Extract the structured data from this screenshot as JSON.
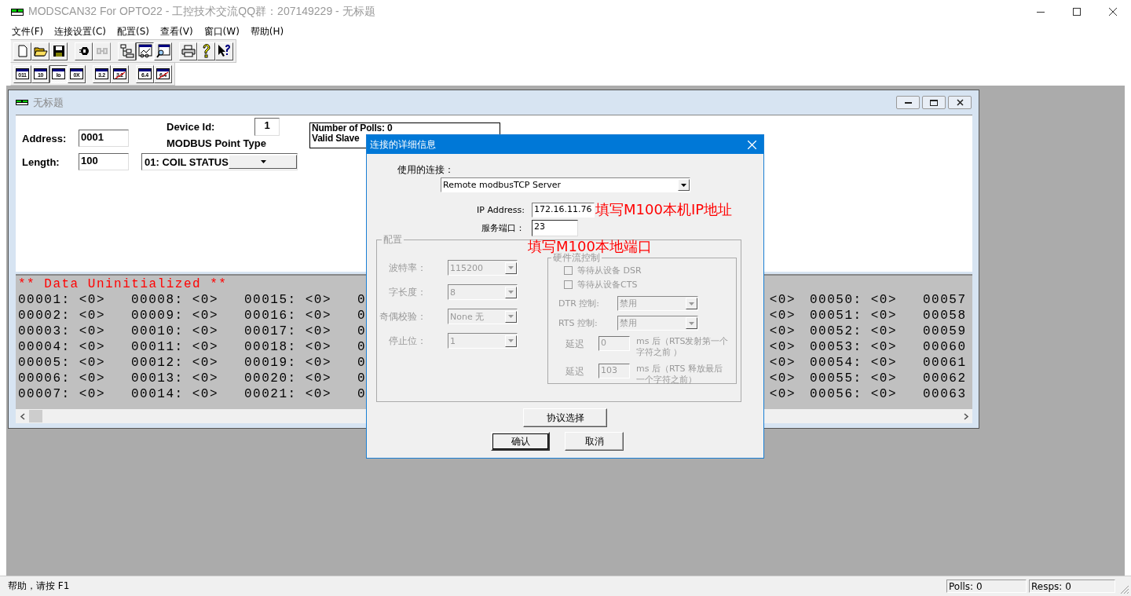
{
  "window": {
    "title": "MODSCAN32 For OPTO22 - 工控技术交流QQ群：207149229 - 无标题"
  },
  "menu": [
    "文件(F)",
    "连接设置(C)",
    "配置(S)",
    "查看(V)",
    "窗口(W)",
    "帮助(H)"
  ],
  "toolbar": [
    {
      "kind": "new",
      "disabled": false,
      "pressed": false
    },
    {
      "kind": "open",
      "disabled": false,
      "pressed": false
    },
    {
      "kind": "save",
      "disabled": false,
      "pressed": false
    },
    {
      "kind": "separator"
    },
    {
      "kind": "connect",
      "disabled": false,
      "pressed": false
    },
    {
      "kind": "disconnect",
      "disabled": true,
      "pressed": false
    },
    {
      "kind": "separator"
    },
    {
      "kind": "tree",
      "disabled": false,
      "pressed": false
    },
    {
      "kind": "display",
      "disabled": false,
      "pressed": true
    },
    {
      "kind": "inspect",
      "disabled": false,
      "pressed": false
    },
    {
      "kind": "separator"
    },
    {
      "kind": "print",
      "disabled": false,
      "pressed": false
    },
    {
      "kind": "help",
      "disabled": false,
      "pressed": false
    },
    {
      "kind": "contexthelp",
      "disabled": false,
      "pressed": false
    }
  ],
  "format_toolbar": [
    {
      "kind": "plain",
      "label": "011",
      "pressed": false
    },
    {
      "kind": "plain",
      "label": "10",
      "pressed": false
    },
    {
      "kind": "plain",
      "label": "Io",
      "pressed": true
    },
    {
      "kind": "plain",
      "label": "0X",
      "pressed": false
    },
    {
      "kind": "separator"
    },
    {
      "kind": "plain",
      "label": "3.2",
      "pressed": false
    },
    {
      "kind": "swapped",
      "label": "3.2",
      "pressed": false
    },
    {
      "kind": "separator"
    },
    {
      "kind": "plain",
      "label": "6.4",
      "pressed": false
    },
    {
      "kind": "swapped",
      "label": "6.4",
      "pressed": false
    }
  ],
  "child_window": {
    "title": "无标题",
    "address_label": "Address:",
    "address": "0001",
    "length_label": "Length:",
    "length": "100",
    "device_id_label": "Device Id:",
    "device_id": "1",
    "point_type_label": "MODBUS Point Type",
    "point_type": "01: COIL STATUS",
    "stats": [
      "Number of Polls: 0",
      "Valid Slave"
    ],
    "data_header": "** Data Uninitialized **",
    "data_columns_left": [
      {
        "entries": [
          "00001: <0>",
          "00002: <0>",
          "00003: <0>",
          "00004: <0>",
          "00005: <0>",
          "00006: <0>",
          "00007: <0>"
        ]
      },
      {
        "entries": [
          "00008: <0>",
          "00009: <0>",
          "00010: <0>",
          "00011: <0>",
          "00012: <0>",
          "00013: <0>",
          "00014: <0>"
        ]
      },
      {
        "entries": [
          "00015: <0>",
          "00016: <0>",
          "00017: <0>",
          "00018: <0>",
          "00019: <0>",
          "00020: <0>",
          "00021: <0>"
        ]
      },
      {
        "entries": [
          "0",
          "0",
          "0",
          "0",
          "0",
          "0",
          "0"
        ]
      }
    ],
    "data_columns_right": [
      {
        "entries": [
          "<0>",
          "<0>",
          "<0>",
          "<0>",
          "<0>",
          "<0>",
          "<0>"
        ]
      },
      {
        "entries": [
          "00050: <0>",
          "00051: <0>",
          "00052: <0>",
          "00053: <0>",
          "00054: <0>",
          "00055: <0>",
          "00056: <0>"
        ]
      },
      {
        "entries": [
          "00057",
          "00058",
          "00059",
          "00060",
          "00061",
          "00062",
          "00063"
        ]
      }
    ]
  },
  "dialog": {
    "title": "连接的详细信息",
    "connection_label": "使用的连接：",
    "connection": "Remote modbusTCP Server",
    "ip_label": "IP Address:",
    "ip": "172.16.11.76",
    "port_label": "服务端口：",
    "port": "23",
    "annotations": [
      "填写M100本机IP地址",
      "填写M100本地端口"
    ],
    "config": {
      "title": "配置",
      "disabled": true,
      "fields": [
        {
          "label": "波特率：",
          "value": "115200"
        },
        {
          "label": "字长度：",
          "value": "8"
        },
        {
          "label": "奇偶校验：",
          "value": "None 无"
        },
        {
          "label": "停止位：",
          "value": "1"
        }
      ],
      "flow_control": {
        "title": "硬件流控制",
        "checkboxes": [
          {
            "label": "等待从设备 DSR",
            "checked": false
          },
          {
            "label": "等待从设备CTS",
            "checked": false
          }
        ],
        "selects": [
          {
            "label": "DTR 控制:",
            "value": "禁用"
          },
          {
            "label": "RTS 控制:",
            "value": "禁用"
          }
        ],
        "delays": [
          {
            "label": "延迟",
            "value": "0",
            "note": "ms 后（RTS发射第一个字符之前 ）"
          },
          {
            "label": "延迟",
            "value": "103",
            "note": "ms 后（RTS 释放最后一个字符之前）"
          }
        ]
      }
    },
    "buttons": [
      "协议选择",
      "确认",
      "取消"
    ]
  },
  "status_bar": {
    "help": "帮助，请按 F1",
    "polls": "Polls: 0",
    "resps": "Resps: 0"
  }
}
